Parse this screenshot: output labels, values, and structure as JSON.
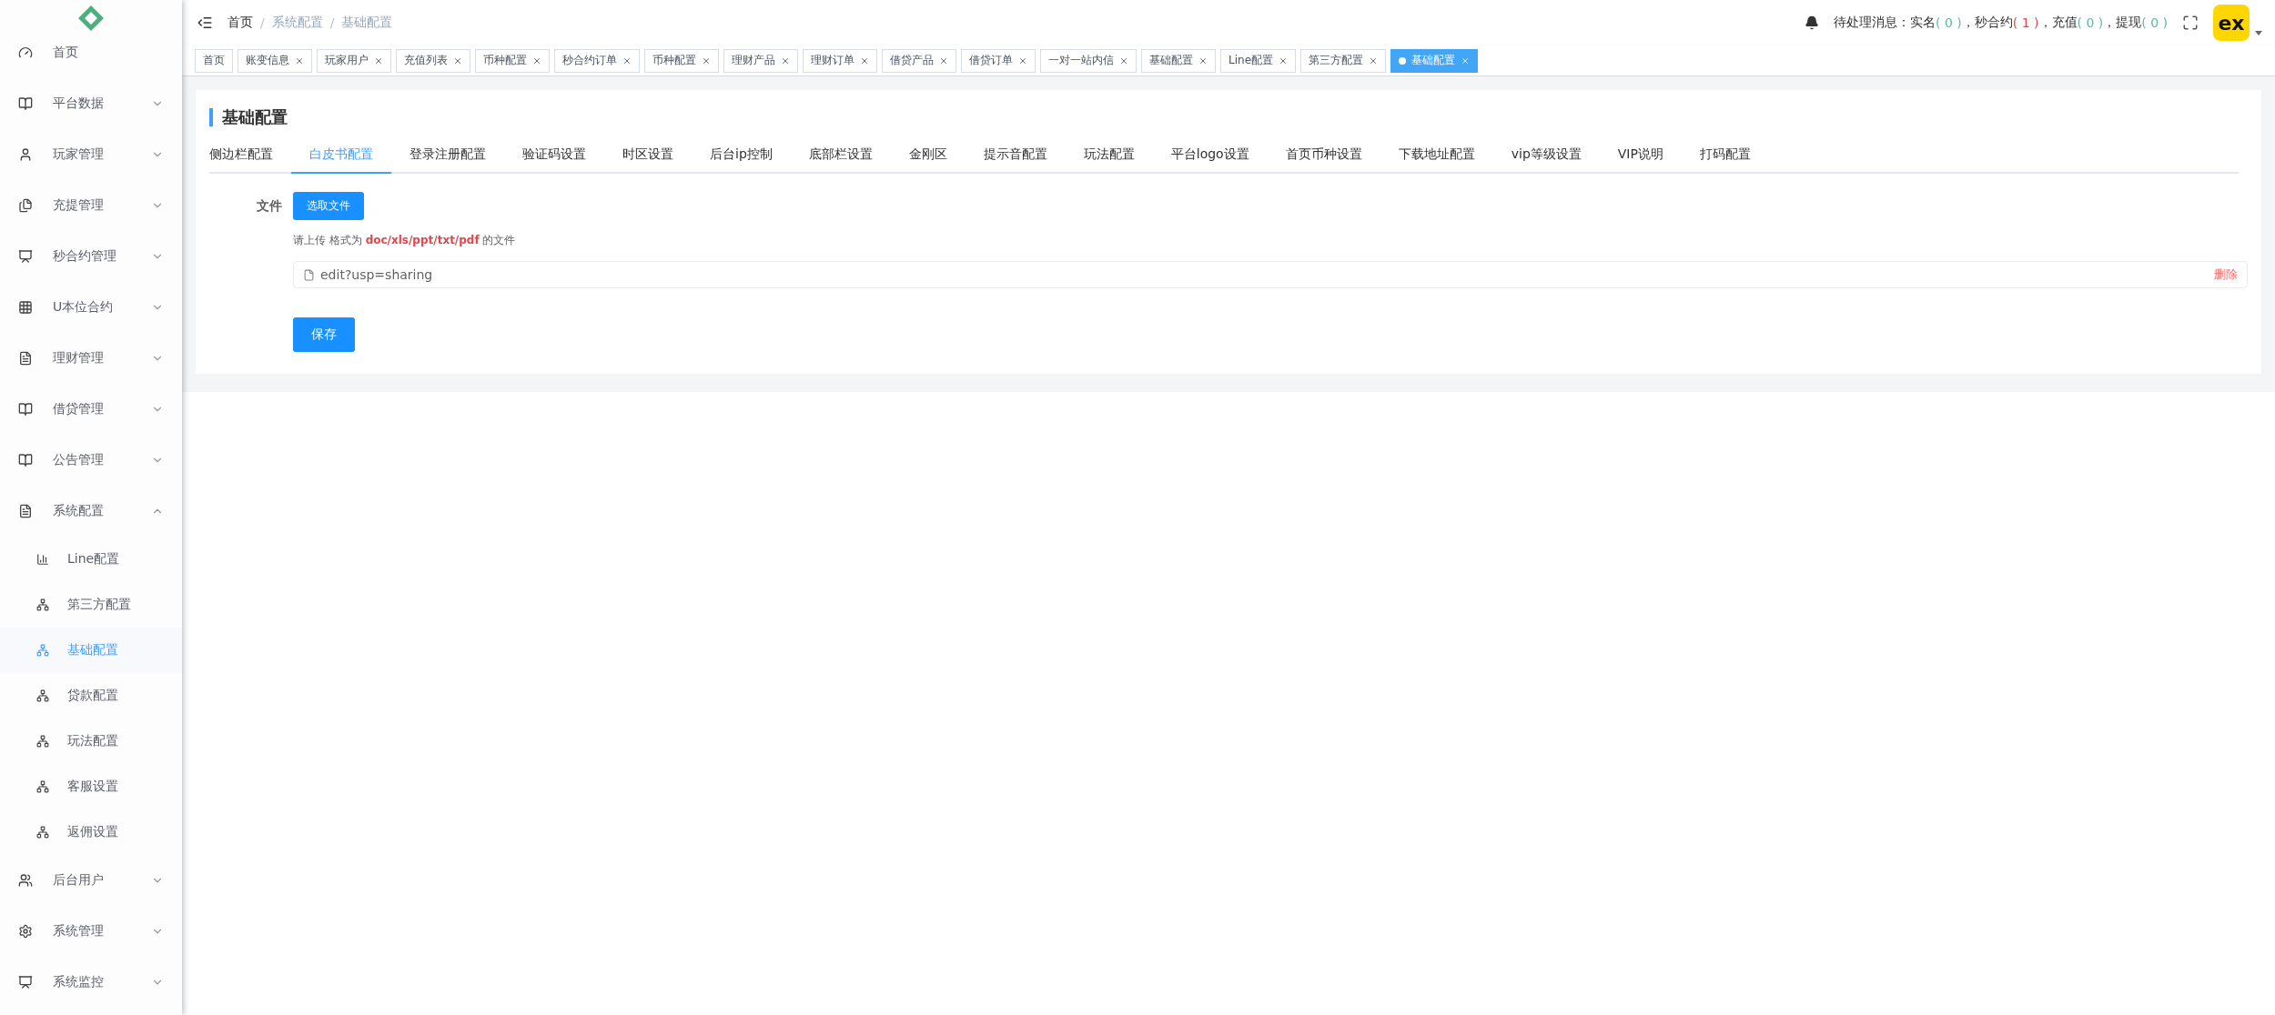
{
  "sidebar": {
    "items": [
      {
        "label": "首页",
        "kind": "link"
      },
      {
        "label": "平台数据",
        "kind": "group",
        "expanded": false
      },
      {
        "label": "玩家管理",
        "kind": "group",
        "expanded": false
      },
      {
        "label": "充提管理",
        "kind": "group",
        "expanded": false
      },
      {
        "label": "秒合约管理",
        "kind": "group",
        "expanded": false
      },
      {
        "label": "U本位合约",
        "kind": "group",
        "expanded": false
      },
      {
        "label": "理财管理",
        "kind": "group",
        "expanded": false
      },
      {
        "label": "借贷管理",
        "kind": "group",
        "expanded": false
      },
      {
        "label": "公告管理",
        "kind": "group",
        "expanded": false
      },
      {
        "label": "系统配置",
        "kind": "group",
        "expanded": true,
        "children": [
          {
            "label": "Line配置",
            "selected": false
          },
          {
            "label": "第三方配置",
            "selected": false
          },
          {
            "label": "基础配置",
            "selected": true
          },
          {
            "label": "贷款配置",
            "selected": false
          },
          {
            "label": "玩法配置",
            "selected": false
          },
          {
            "label": "客服设置",
            "selected": false
          },
          {
            "label": "返佣设置",
            "selected": false
          }
        ]
      },
      {
        "label": "后台用户",
        "kind": "group",
        "expanded": false
      },
      {
        "label": "系统管理",
        "kind": "group",
        "expanded": false
      },
      {
        "label": "系统监控",
        "kind": "group",
        "expanded": false
      }
    ]
  },
  "breadcrumb_separator": "/",
  "breadcrumb": [
    {
      "label": "首页",
      "current": false
    },
    {
      "label": "系统配置",
      "current": true
    },
    {
      "label": "基础配置",
      "current": true
    }
  ],
  "notice": {
    "label": "待处理消息：",
    "separator": "，",
    "counts": [
      {
        "label": "实名",
        "count": "( 0 )",
        "color": "#5fb8a8"
      },
      {
        "label": "秒合约",
        "count": "( 1 )",
        "color": "#e0474c"
      },
      {
        "label": "充值",
        "count": "( 0 )",
        "color": "#5fb8a8"
      },
      {
        "label": "提现",
        "count": "( 0 )",
        "color": "#5fb8a8"
      }
    ]
  },
  "avatar": {
    "text": "ex"
  },
  "tags": [
    {
      "label": "首页",
      "closable": false,
      "selected": false
    },
    {
      "label": "账变信息",
      "closable": true,
      "selected": false
    },
    {
      "label": "玩家用户",
      "closable": true,
      "selected": false
    },
    {
      "label": "充值列表",
      "closable": true,
      "selected": false
    },
    {
      "label": "币种配置",
      "closable": true,
      "selected": false
    },
    {
      "label": "秒合约订单",
      "closable": true,
      "selected": false
    },
    {
      "label": "币种配置",
      "closable": true,
      "selected": false
    },
    {
      "label": "理财产品",
      "closable": true,
      "selected": false
    },
    {
      "label": "理财订单",
      "closable": true,
      "selected": false
    },
    {
      "label": "借贷产品",
      "closable": true,
      "selected": false
    },
    {
      "label": "借贷订单",
      "closable": true,
      "selected": false
    },
    {
      "label": "一对一站内信",
      "closable": true,
      "selected": false
    },
    {
      "label": "基础配置",
      "closable": true,
      "selected": false
    },
    {
      "label": "Line配置",
      "closable": true,
      "selected": false
    },
    {
      "label": "第三方配置",
      "closable": true,
      "selected": false
    },
    {
      "label": "基础配置",
      "closable": true,
      "selected": true
    }
  ],
  "panel": {
    "title": "基础配置",
    "tabs": [
      {
        "label": "侧边栏配置",
        "selected": false
      },
      {
        "label": "白皮书配置",
        "selected": true
      },
      {
        "label": "登录注册配置",
        "selected": false
      },
      {
        "label": "验证码设置",
        "selected": false
      },
      {
        "label": "时区设置",
        "selected": false
      },
      {
        "label": "后台ip控制",
        "selected": false
      },
      {
        "label": "底部栏设置",
        "selected": false
      },
      {
        "label": "金刚区",
        "selected": false
      },
      {
        "label": "提示音配置",
        "selected": false
      },
      {
        "label": "玩法配置",
        "selected": false
      },
      {
        "label": "平台logo设置",
        "selected": false
      },
      {
        "label": "首页币种设置",
        "selected": false
      },
      {
        "label": "下载地址配置",
        "selected": false
      },
      {
        "label": "vip等级设置",
        "selected": false
      },
      {
        "label": "VIP说明",
        "selected": false
      },
      {
        "label": "打码配置",
        "selected": false
      }
    ],
    "form": {
      "label": "文件",
      "choose_button": "选取文件",
      "hint": "请上传 格式为 **doc/xls/ppt/txt/pdf** 的文件",
      "files": [
        {
          "name": "edit?usp=sharing",
          "action": "删除"
        }
      ],
      "save_button": "保存"
    }
  }
}
